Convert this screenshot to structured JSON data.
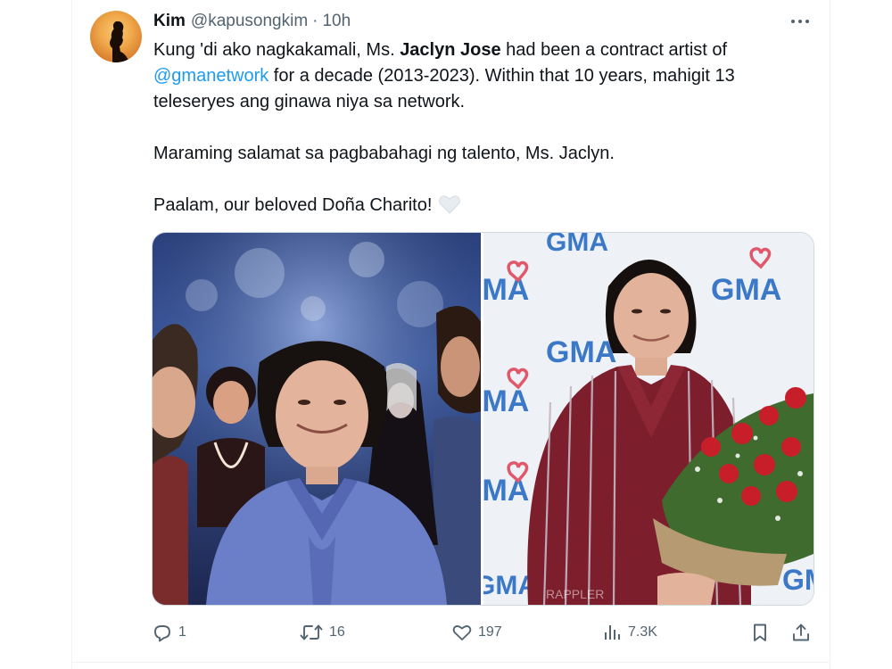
{
  "tweet": {
    "author": {
      "display_name": "Kim",
      "handle": "@kapusongkim",
      "time_separator": "·",
      "timestamp": "10h"
    },
    "text": {
      "line1_before": "Kung 'di ako nagkakamali, Ms. ",
      "line1_bold": "Jaclyn Jose",
      "line1_after": " had been a contract artist of",
      "mention": "@gmanetwork",
      "line2_after": " for a decade (2013-2023). Within that 10 years, mahigit 13",
      "line3": "teleseryes ang ginawa niya sa network.",
      "paragraph2": "Maraming salamat sa pagbabahagi ng talento, Ms. Jaclyn.",
      "paragraph3": "Paalam, our beloved Doña Charito!"
    },
    "media": {
      "right_backdrop_text": "GMA",
      "right_watermark": "RAPPLER"
    },
    "actions": {
      "replies": "1",
      "reposts": "16",
      "likes": "197",
      "views": "7.3K"
    }
  },
  "icons": {
    "more": "more-horizontal-icon",
    "heart_emoji": "white-heart-emoji-icon",
    "reply": "reply-icon",
    "repost": "repost-icon",
    "like": "heart-icon",
    "views": "views-icon",
    "bookmark": "bookmark-icon",
    "share": "share-icon"
  },
  "colors": {
    "text_primary": "#0f1419",
    "text_secondary": "#536471",
    "link": "#1d9bf0",
    "border": "#cfd9de"
  }
}
